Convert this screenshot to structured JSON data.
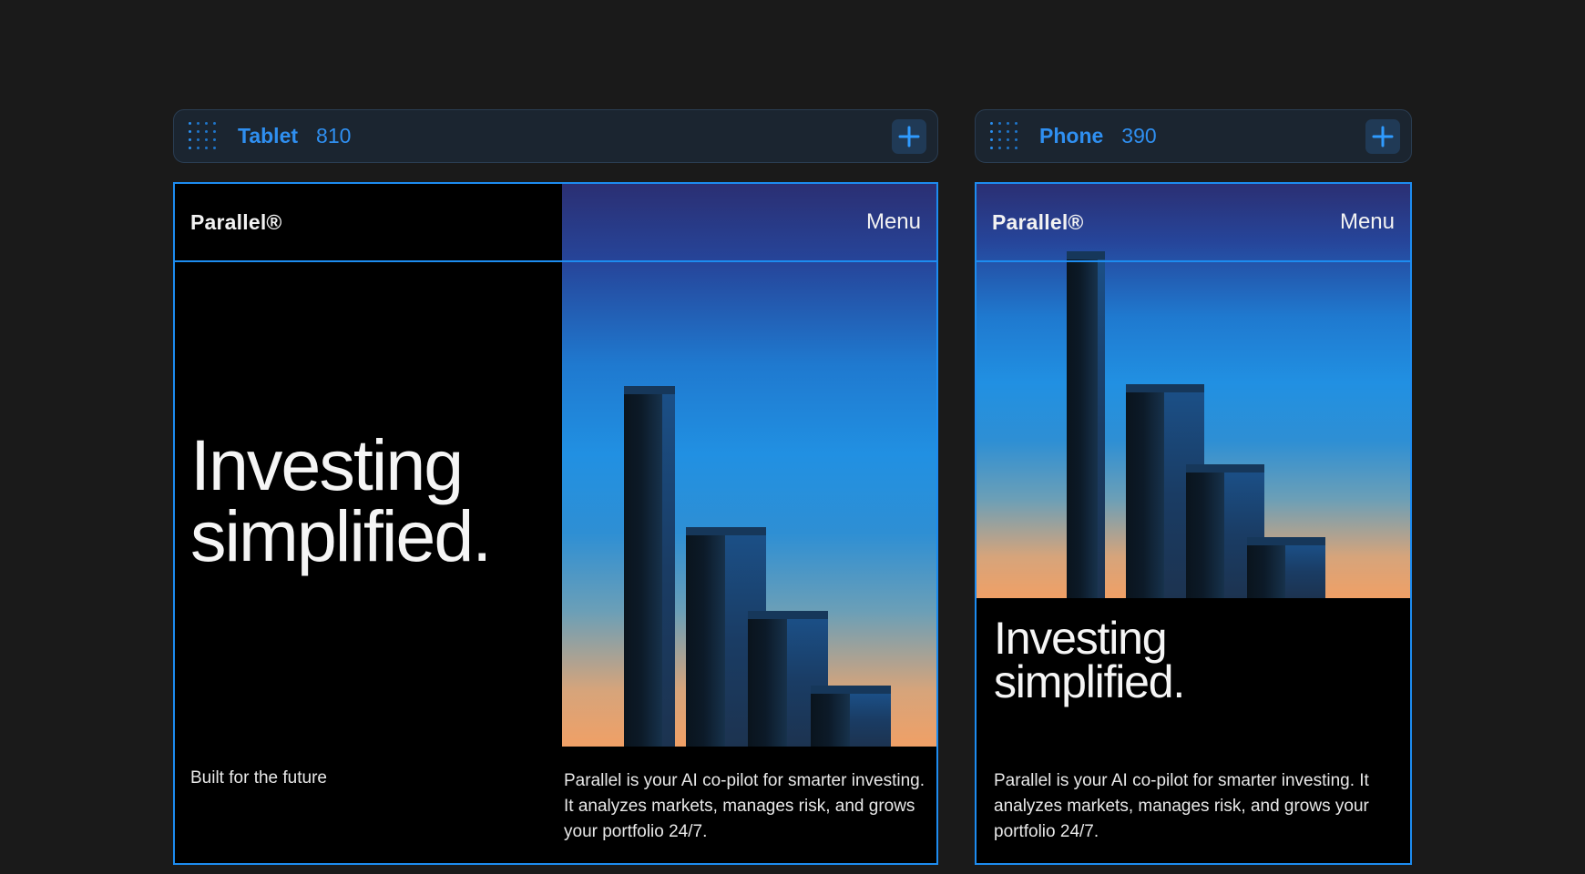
{
  "canvas_background": "#1a1a1a",
  "accent_color": "#1d8cf0",
  "breakpoints": [
    {
      "name": "Tablet",
      "width_label": "810",
      "handle_icon": "drag-handle-icon",
      "add_icon": "plus-icon"
    },
    {
      "name": "Phone",
      "width_label": "390",
      "handle_icon": "drag-handle-icon",
      "add_icon": "plus-icon"
    }
  ],
  "site": {
    "logo": "Parallel®",
    "menu_label": "Menu",
    "headline_line1": "Investing",
    "headline_line2": "simplified.",
    "tagline": "Built for the future",
    "body": "Parallel is your AI co-pilot for smarter investing. It analyzes markets, manages risk, and grows your portfolio 24/7.",
    "hero_image": "3d-bar-towers-gradient-sky"
  }
}
